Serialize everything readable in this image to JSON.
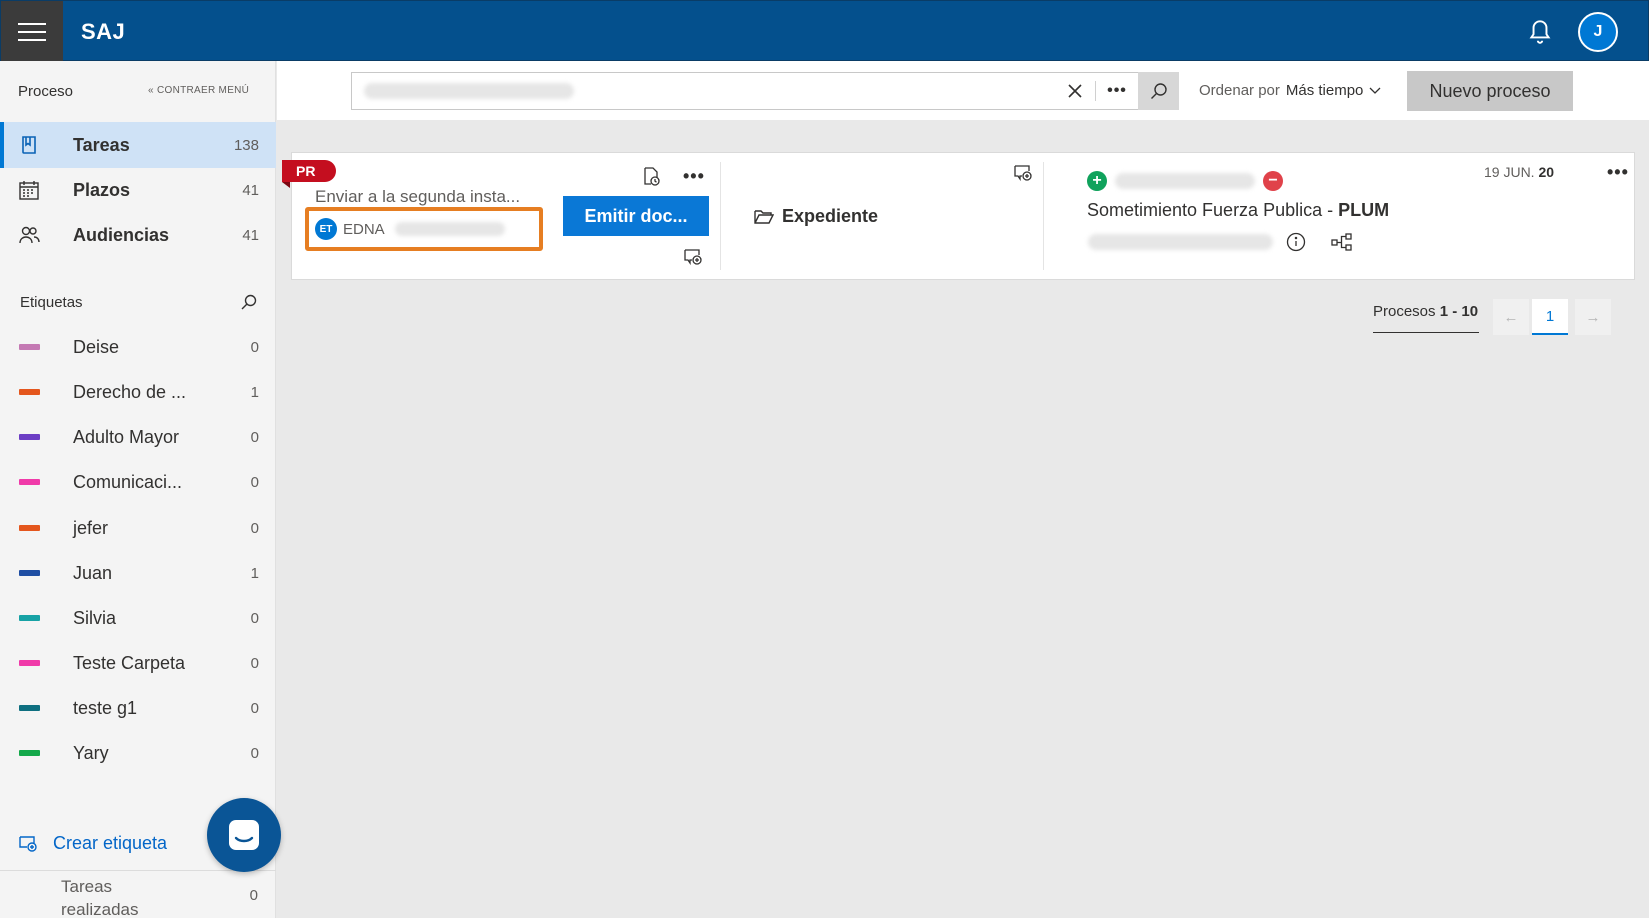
{
  "header": {
    "brand": "SAJ",
    "user_initial": "J"
  },
  "sidebar": {
    "section_title": "Proceso",
    "collapse_label": "CONTRAER MENÚ",
    "nav": [
      {
        "label": "Tareas",
        "count": "138",
        "icon": "book-icon",
        "active": true
      },
      {
        "label": "Plazos",
        "count": "41",
        "icon": "calendar-icon",
        "active": false
      },
      {
        "label": "Audiencias",
        "count": "41",
        "icon": "people-icon",
        "active": false
      }
    ],
    "labels_title": "Etiquetas",
    "labels": [
      {
        "label": "Deise",
        "count": "0",
        "color": "#c479b3"
      },
      {
        "label": "Derecho de ...",
        "count": "1",
        "color": "#e4561d"
      },
      {
        "label": "Adulto Mayor",
        "count": "0",
        "color": "#6c3ec4"
      },
      {
        "label": "Comunicaci...",
        "count": "0",
        "color": "#f03aa9"
      },
      {
        "label": "jefer",
        "count": "0",
        "color": "#e4561d"
      },
      {
        "label": "Juan",
        "count": "1",
        "color": "#1f4ea3"
      },
      {
        "label": "Silvia",
        "count": "0",
        "color": "#17a2a5"
      },
      {
        "label": "Teste Carpeta",
        "count": "0",
        "color": "#f03aa9"
      },
      {
        "label": "teste g1",
        "count": "0",
        "color": "#0e6f80"
      },
      {
        "label": "Yary",
        "count": "0",
        "color": "#13a84a"
      }
    ],
    "create_label": "Crear etiqueta",
    "done_label": "Tareas realizadas",
    "done_count": "0"
  },
  "toolbar": {
    "search_value": "",
    "more_label": "•••",
    "sort_prefix": "Ordenar por",
    "sort_value": "Más tiempo",
    "new_button": "Nuevo proceso"
  },
  "card": {
    "tag": "PR",
    "task_title": "Enviar a la segunda insta...",
    "assignee_initials": "ET",
    "assignee_name": "EDNA",
    "primary_action": "Emitir doc...",
    "more_label": "•••",
    "expediente": "Expediente",
    "case_title": "Sometimiento Fuerza Publica - ",
    "case_code": "PLUM",
    "date_day": "19 JUN.",
    "date_year": "20"
  },
  "pagination": {
    "prefix": "Procesos",
    "range": "1 - 10",
    "current": "1",
    "prev_icon": "←",
    "next_icon": "→"
  }
}
